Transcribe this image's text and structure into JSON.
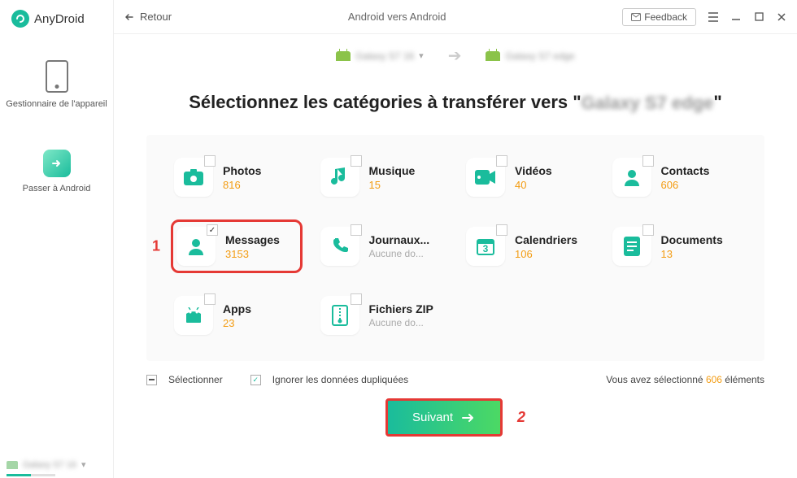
{
  "app_name": "AnyDroid",
  "back_label": "Retour",
  "header_title": "Android vers Android",
  "feedback_label": "Feedback",
  "sidebar": {
    "device_manager": "Gestionnaire de l'appareil",
    "switch_to_android": "Passer à Android"
  },
  "source_device": "Galaxy S7 16",
  "target_device": "Galaxy S7 edge",
  "title_prefix": "Sélectionnez les catégories à transférer vers \"",
  "title_suffix": "\"",
  "categories": [
    {
      "name": "Photos",
      "count": "816"
    },
    {
      "name": "Musique",
      "count": "15"
    },
    {
      "name": "Vidéos",
      "count": "40"
    },
    {
      "name": "Contacts",
      "count": "606"
    },
    {
      "name": "Messages",
      "count": "3153",
      "checked": true,
      "highlight": true
    },
    {
      "name": "Journaux...",
      "muted": "Aucune do..."
    },
    {
      "name": "Calendriers",
      "count": "106"
    },
    {
      "name": "Documents",
      "count": "13"
    },
    {
      "name": "Apps",
      "count": "23"
    },
    {
      "name": "Fichiers ZIP",
      "muted": "Aucune do..."
    }
  ],
  "select_label": "Sélectionner",
  "ignore_label": "Ignorer les données dupliquées",
  "status_prefix": "Vous avez sélectionné ",
  "status_count": "606",
  "status_suffix": " éléments",
  "next_label": "Suivant",
  "callout1": "1",
  "callout2": "2",
  "footer_device": "Galaxy S7 16"
}
